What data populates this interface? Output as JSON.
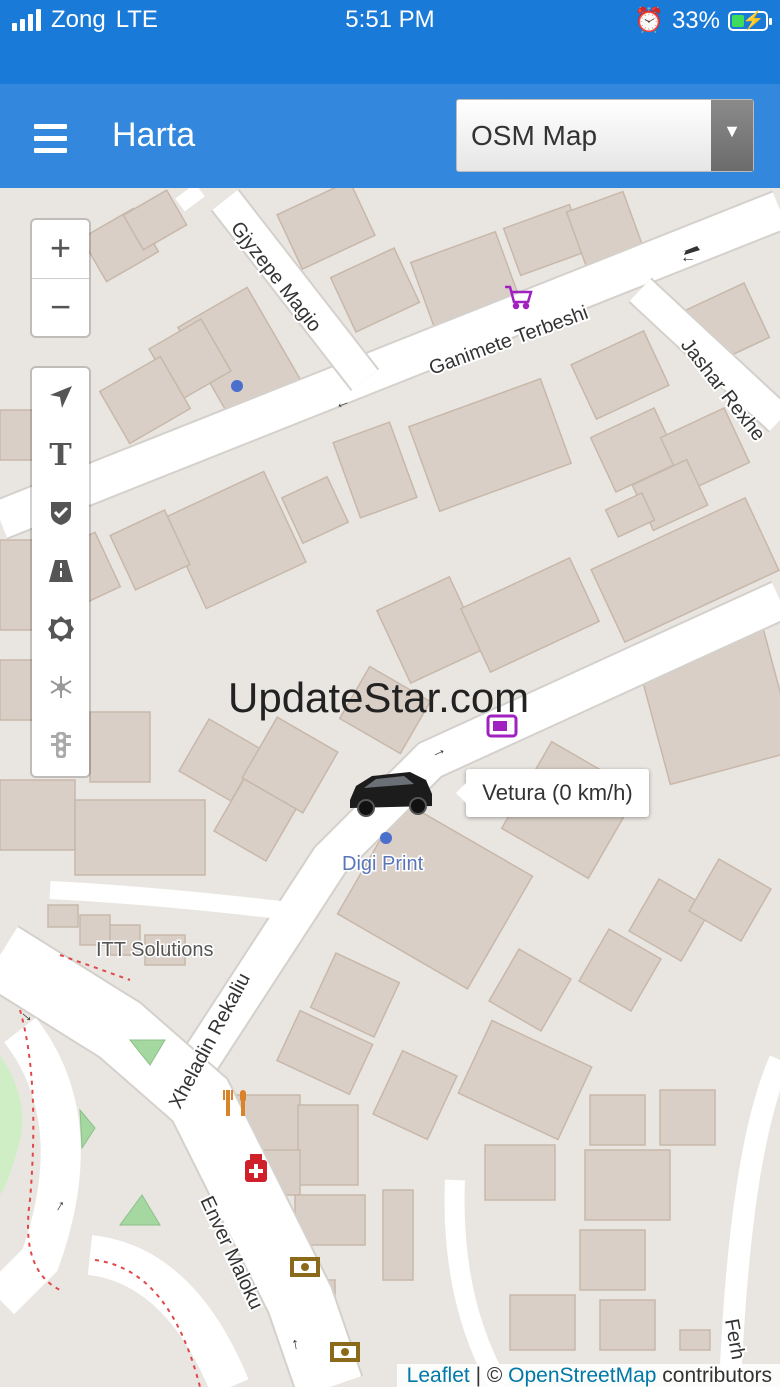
{
  "status_bar": {
    "carrier": "Zong",
    "network": "LTE",
    "time": "5:51 PM",
    "battery_percent": "33%",
    "signal_bars": 4
  },
  "app_bar": {
    "title": "Harta",
    "menu_icon": "hamburger-menu-icon",
    "map_select": {
      "selected": "OSM Map"
    }
  },
  "map": {
    "street_labels": [
      "Gjyzepe Magio",
      "Ganimete Terbeshi",
      "Jashar Rexhe",
      "Xheladin Rekaliu",
      "Enver Maloku",
      "Ferh"
    ],
    "poi_labels": [
      "Digi Print",
      "ITT Solutions"
    ],
    "vehicle_tooltip": "Vetura (0 km/h)",
    "watermark": "UpdateStar.com",
    "attribution": {
      "leaflet": "Leaflet",
      "separator": "| ©",
      "osm": "OpenStreetMap",
      "suffix": "contributors"
    },
    "colors": {
      "background": "#e9e6e2",
      "building": "#d9cfc6",
      "road": "#ffffff",
      "shop_purple": "#a020c0",
      "food_orange": "#d9842a",
      "pharmacy_red": "#d0202a"
    }
  },
  "map_controls": {
    "zoom_in": "+",
    "zoom_out": "−",
    "tools": [
      "navigate-arrow-icon",
      "text-tool-icon",
      "shield-check-icon",
      "road-icon",
      "sun-gear-icon",
      "network-node-icon",
      "traffic-light-icon"
    ]
  }
}
